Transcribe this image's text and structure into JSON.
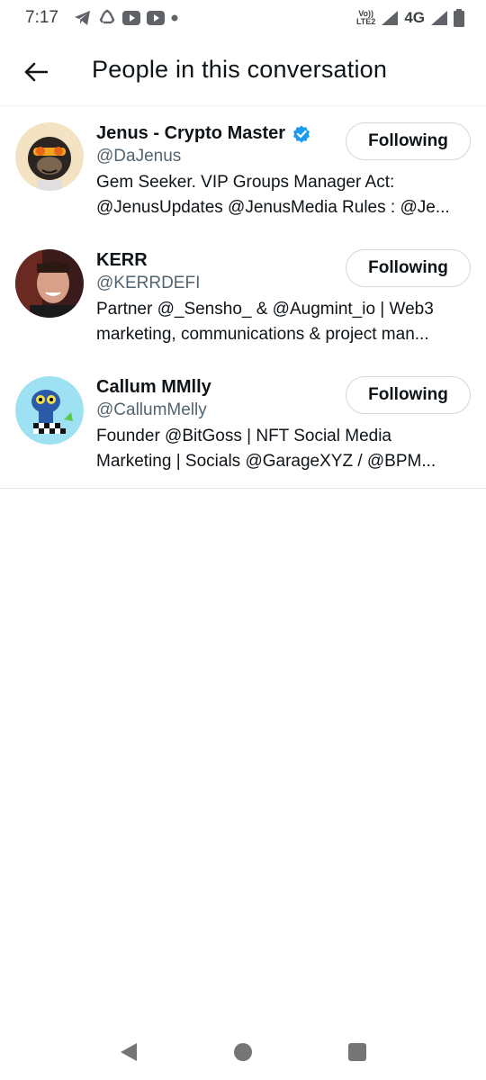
{
  "status_bar": {
    "time": "7:17",
    "volte_top": "Vo))",
    "volte_bottom": "LTE2",
    "network": "4G"
  },
  "header": {
    "title": "People in this conversation"
  },
  "people": [
    {
      "name": "Jenus - Crypto Master",
      "verified": true,
      "handle": "@DaJenus",
      "bio_line1": "Gem Seeker. VIP Groups Manager  Act:",
      "bio_line2": "@JenusUpdates @JenusMedia Rules : @Je...",
      "button_label": "Following"
    },
    {
      "name": "KERR",
      "verified": false,
      "handle": "@KERRDEFI",
      "bio_line1": "Partner @_Sensho_ & @Augmint_io | Web3",
      "bio_line2": "marketing, communications & project man...",
      "button_label": "Following"
    },
    {
      "name": "Callum MΜlly",
      "verified": false,
      "handle": "@CallumMelly",
      "bio_line1": "Founder @BitGoss | NFT Social Media",
      "bio_line2": "Marketing | Socials @GarageXYZ / @BPM...",
      "button_label": "Following"
    }
  ],
  "colors": {
    "text_primary": "#0f1419",
    "text_secondary": "#536471",
    "verified_blue": "#1d9bf0",
    "divider": "#eff3f4"
  },
  "icons": {
    "back": "arrow-left-icon",
    "verified": "verified-badge-icon"
  }
}
